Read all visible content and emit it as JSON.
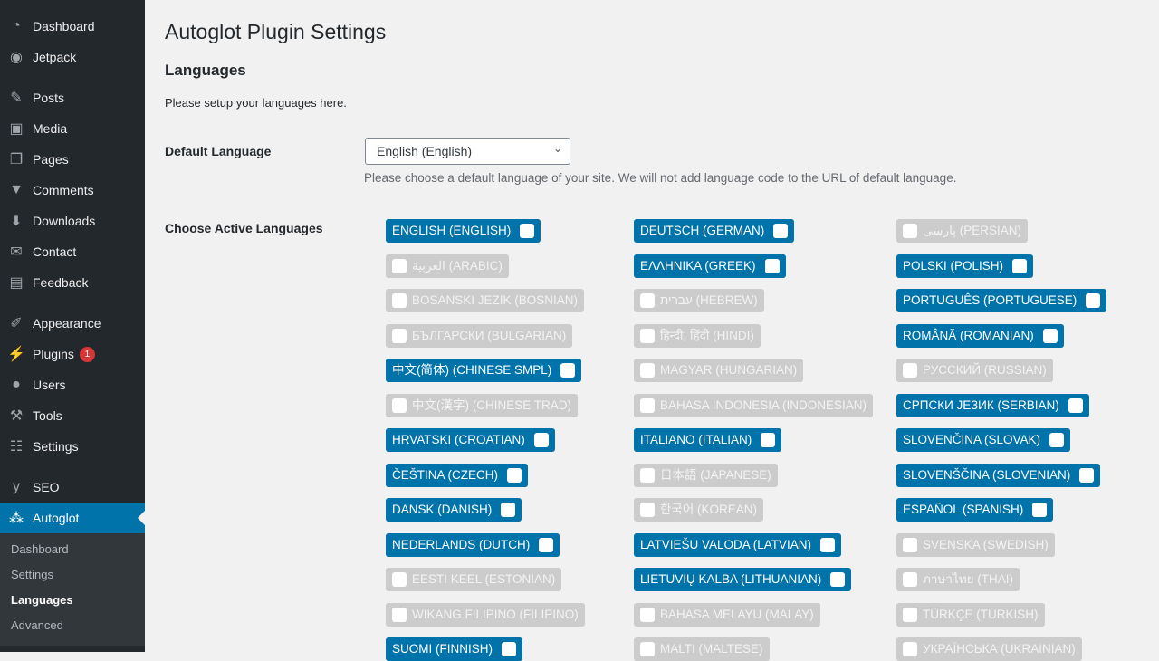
{
  "sidebar": {
    "items": [
      {
        "label": "Dashboard",
        "icon": "dashboard-icon",
        "glyph": "◔"
      },
      {
        "label": "Jetpack",
        "icon": "jetpack-icon",
        "glyph": "◉"
      },
      {
        "label": "Posts",
        "icon": "pin-icon",
        "glyph": "✎"
      },
      {
        "label": "Media",
        "icon": "media-icon",
        "glyph": "▣"
      },
      {
        "label": "Pages",
        "icon": "pages-icon",
        "glyph": "❐"
      },
      {
        "label": "Comments",
        "icon": "comment-icon",
        "glyph": "▼"
      },
      {
        "label": "Downloads",
        "icon": "download-icon",
        "glyph": "⬇"
      },
      {
        "label": "Contact",
        "icon": "mail-icon",
        "glyph": "✉"
      },
      {
        "label": "Feedback",
        "icon": "feedback-icon",
        "glyph": "▤"
      },
      {
        "label": "Appearance",
        "icon": "brush-icon",
        "glyph": "✐"
      },
      {
        "label": "Plugins",
        "icon": "plugin-icon",
        "glyph": "⚡",
        "badge": "1"
      },
      {
        "label": "Users",
        "icon": "user-icon",
        "glyph": "●"
      },
      {
        "label": "Tools",
        "icon": "wrench-icon",
        "glyph": "⚒"
      },
      {
        "label": "Settings",
        "icon": "settings-icon",
        "glyph": "☷"
      },
      {
        "label": "SEO",
        "icon": "yoast-icon",
        "glyph": "y"
      },
      {
        "label": "Autoglot",
        "icon": "autoglot-icon",
        "glyph": "⁂"
      }
    ],
    "submenu": [
      "Dashboard",
      "Settings",
      "Languages",
      "Advanced"
    ]
  },
  "page": {
    "title": "Autoglot Plugin Settings",
    "section": "Languages",
    "section_desc": "Please setup your languages here.",
    "default_label": "Default Language",
    "default_value": "English (English)",
    "default_help": "Please choose a default language of your site. We will not add language code to the URL of default language.",
    "active_label": "Choose Active Languages"
  },
  "languages": [
    [
      {
        "l": "ENGLISH (ENGLISH)",
        "on": true
      },
      {
        "l": "العربية (ARABIC)",
        "on": false
      },
      {
        "l": "BOSANSKI JEZIK (BOSNIAN)",
        "on": false
      },
      {
        "l": "БЪЛГАРСКИ (BULGARIAN)",
        "on": false
      },
      {
        "l": "中文(简体) (CHINESE SMPL)",
        "on": true
      },
      {
        "l": "中文(漢字) (CHINESE TRAD)",
        "on": false
      },
      {
        "l": "HRVATSKI (CROATIAN)",
        "on": true
      },
      {
        "l": "ČEŠTINA (CZECH)",
        "on": true
      },
      {
        "l": "DANSK (DANISH)",
        "on": true
      },
      {
        "l": "NEDERLANDS (DUTCH)",
        "on": true
      },
      {
        "l": "EESTI KEEL (ESTONIAN)",
        "on": false
      },
      {
        "l": "WIKANG FILIPINO (FILIPINO)",
        "on": false
      },
      {
        "l": "SUOMI (FINNISH)",
        "on": true
      }
    ],
    [
      {
        "l": "DEUTSCH (GERMAN)",
        "on": true
      },
      {
        "l": "ΕΛΛΗΝΙΚΑ (GREEK)",
        "on": true
      },
      {
        "l": "עברית (HEBREW)",
        "on": false
      },
      {
        "l": "हिन्दी; हिंदी (HINDI)",
        "on": false
      },
      {
        "l": "MAGYAR (HUNGARIAN)",
        "on": false
      },
      {
        "l": "BAHASA INDONESIA (INDONESIAN)",
        "on": false
      },
      {
        "l": "ITALIANO (ITALIAN)",
        "on": true
      },
      {
        "l": "日本語 (JAPANESE)",
        "on": false
      },
      {
        "l": "한국어 (KOREAN)",
        "on": false
      },
      {
        "l": "LATVIEŠU VALODA (LATVIAN)",
        "on": true
      },
      {
        "l": "LIETUVIŲ KALBA (LITHUANIAN)",
        "on": true
      },
      {
        "l": "BAHASA MELAYU (MALAY)",
        "on": false
      },
      {
        "l": "MALTI (MALTESE)",
        "on": false
      }
    ],
    [
      {
        "l": "پارسی (PERSIAN)",
        "on": false
      },
      {
        "l": "POLSKI (POLISH)",
        "on": true
      },
      {
        "l": "PORTUGUÊS (PORTUGUESE)",
        "on": true
      },
      {
        "l": "ROMÂNĂ (ROMANIAN)",
        "on": true
      },
      {
        "l": "РУССКИЙ (RUSSIAN)",
        "on": false
      },
      {
        "l": "СРПСКИ ЈЕЗИК (SERBIAN)",
        "on": true
      },
      {
        "l": "SLOVENČINA (SLOVAK)",
        "on": true
      },
      {
        "l": "SLOVENŠČINA (SLOVENIAN)",
        "on": true
      },
      {
        "l": "ESPAÑOL (SPANISH)",
        "on": true
      },
      {
        "l": "SVENSKA (SWEDISH)",
        "on": false
      },
      {
        "l": "ภาษาไทย (THAI)",
        "on": false
      },
      {
        "l": "TÜRKÇE (TURKISH)",
        "on": false
      },
      {
        "l": "УКРАЇНСЬКА (UKRAINIAN)",
        "on": false
      }
    ]
  ]
}
